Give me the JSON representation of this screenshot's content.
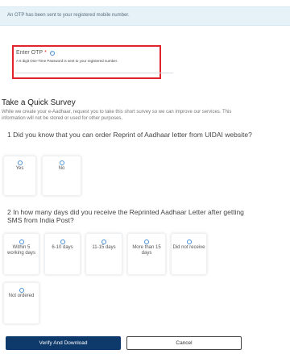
{
  "banner": {
    "text": "An OTP has been sent to your registered mobile number."
  },
  "otp": {
    "label": "Enter OTP",
    "required_marker": "*",
    "hint": "A 6 digit One-Time Password is sent to your registered number."
  },
  "survey": {
    "title": "Take a Quick Survey",
    "description": "While we create your e-Aadhaar, request you to take this short survey so we can improve our services. This information will not be stored or used for other purposes."
  },
  "q1": {
    "text": "1 Did you know that you can order Reprint of Aadhaar letter from UIDAI website?",
    "options": [
      "Yes",
      "No"
    ]
  },
  "q2": {
    "text": "2 In how many days did you receive the Reprinted Aadhaar Letter after getting SMS from India Post?",
    "options": [
      "Within 5 working days",
      "6-10 days",
      "11-15 days",
      "More than 15 days",
      "Did not receive",
      "Not ordered"
    ]
  },
  "buttons": {
    "verify": "Verify And Download",
    "cancel": "Cancel"
  },
  "colors": {
    "accent": "#0e3a6b",
    "highlight": "#e0242b",
    "banner_bg": "#e6f1f8"
  }
}
